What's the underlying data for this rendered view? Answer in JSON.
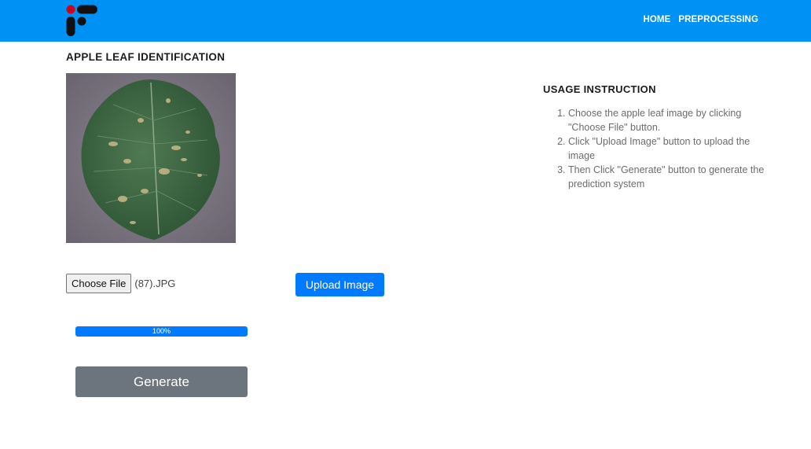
{
  "nav": {
    "links": [
      "HOME",
      "PREPROCESSING"
    ],
    "color": "#0091f4"
  },
  "page": {
    "title": "APPLE LEAF IDENTIFICATION"
  },
  "usage": {
    "title": "USAGE INSTRUCTION",
    "steps": [
      "Choose the apple leaf image by clicking \"Choose File\" button.",
      "Click \"Upload Image\" button to upload the image",
      "Then Click \"Generate\" button to generate the prediction system"
    ]
  },
  "upload": {
    "choose_label": "Choose File",
    "file_name": "(87).JPG",
    "upload_label": "Upload Image"
  },
  "progress": {
    "value": 100,
    "label": "100%"
  },
  "generate": {
    "label": "Generate"
  }
}
